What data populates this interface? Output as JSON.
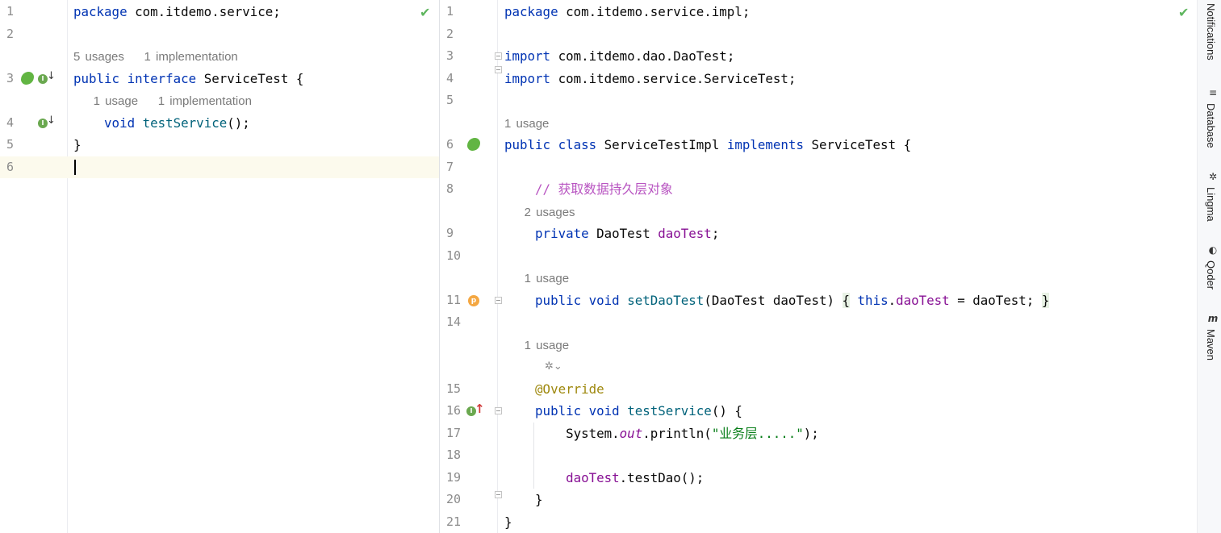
{
  "left_editor": {
    "lines": [
      {
        "num": "1",
        "code": [
          {
            "t": "package",
            "c": "kw"
          },
          {
            "t": " com.itdemo.service;"
          }
        ]
      },
      {
        "num": "2",
        "code": []
      },
      {
        "hint": "5 usages    1 implementation"
      },
      {
        "num": "3",
        "code": [
          {
            "t": "public",
            "c": "kw"
          },
          {
            "t": " "
          },
          {
            "t": "interface",
            "c": "kw"
          },
          {
            "t": " ServiceTest {"
          }
        ]
      },
      {
        "hint": "    1 usage    1 implementation"
      },
      {
        "num": "4",
        "code": [
          {
            "t": "    "
          },
          {
            "t": "void",
            "c": "kw"
          },
          {
            "t": " "
          },
          {
            "t": "testService",
            "c": "fn"
          },
          {
            "t": "();"
          }
        ]
      },
      {
        "num": "5",
        "code": [
          {
            "t": "}"
          }
        ]
      },
      {
        "num": "6",
        "code": [],
        "current": true
      }
    ]
  },
  "right_editor": {
    "lines": [
      {
        "num": "1",
        "code": [
          {
            "t": "package",
            "c": "kw"
          },
          {
            "t": " com.itdemo.service.impl;"
          }
        ]
      },
      {
        "num": "2",
        "code": []
      },
      {
        "num": "3",
        "code": [
          {
            "t": "import",
            "c": "kw"
          },
          {
            "t": " com.itdemo.dao.DaoTest;"
          }
        ]
      },
      {
        "num": "4",
        "code": [
          {
            "t": "import",
            "c": "kw"
          },
          {
            "t": " com.itdemo.service.ServiceTest;"
          }
        ]
      },
      {
        "num": "5",
        "code": []
      },
      {
        "hint": "1 usage"
      },
      {
        "num": "6",
        "code": [
          {
            "t": "public",
            "c": "kw"
          },
          {
            "t": " "
          },
          {
            "t": "class",
            "c": "kw"
          },
          {
            "t": " ServiceTestImpl "
          },
          {
            "t": "implements",
            "c": "kw"
          },
          {
            "t": " ServiceTest {"
          }
        ]
      },
      {
        "num": "7",
        "code": []
      },
      {
        "num": "8",
        "code": [
          {
            "t": "    "
          },
          {
            "t": "// 获取数据持久层对象",
            "c": "cmt"
          }
        ]
      },
      {
        "hint": "    2 usages"
      },
      {
        "num": "9",
        "code": [
          {
            "t": "    "
          },
          {
            "t": "private",
            "c": "kw"
          },
          {
            "t": " DaoTest "
          },
          {
            "t": "daoTest",
            "c": "fld"
          },
          {
            "t": ";"
          }
        ]
      },
      {
        "num": "10",
        "code": []
      },
      {
        "hint": "    1 usage"
      },
      {
        "num": "11",
        "code": [
          {
            "t": "    "
          },
          {
            "t": "public",
            "c": "kw"
          },
          {
            "t": " "
          },
          {
            "t": "void",
            "c": "kw"
          },
          {
            "t": " "
          },
          {
            "t": "setDaoTest",
            "c": "fn"
          },
          {
            "t": "(DaoTest daoTest) "
          },
          {
            "t": "{",
            "c": "brace-hl"
          },
          {
            "t": " "
          },
          {
            "t": "this",
            "c": "kw"
          },
          {
            "t": "."
          },
          {
            "t": "daoTest",
            "c": "fld"
          },
          {
            "t": " = daoTest; "
          },
          {
            "t": "}",
            "c": "brace-hl"
          }
        ]
      },
      {
        "num": "14",
        "code": []
      },
      {
        "hint": "    1 usage"
      },
      {
        "ai": true
      },
      {
        "num": "15",
        "code": [
          {
            "t": "    "
          },
          {
            "t": "@Override",
            "c": "ann"
          }
        ]
      },
      {
        "num": "16",
        "code": [
          {
            "t": "    "
          },
          {
            "t": "public",
            "c": "kw"
          },
          {
            "t": " "
          },
          {
            "t": "void",
            "c": "kw"
          },
          {
            "t": " "
          },
          {
            "t": "testService",
            "c": "fn"
          },
          {
            "t": "() {"
          }
        ]
      },
      {
        "num": "17",
        "code": [
          {
            "t": "        System."
          },
          {
            "t": "out",
            "c": "fld it"
          },
          {
            "t": ".println("
          },
          {
            "t": "\"业务层.....\"",
            "c": "str"
          },
          {
            "t": ");"
          }
        ]
      },
      {
        "num": "18",
        "code": []
      },
      {
        "num": "19",
        "code": [
          {
            "t": "        "
          },
          {
            "t": "daoTest",
            "c": "fld"
          },
          {
            "t": ".testDao();"
          }
        ]
      },
      {
        "num": "20",
        "code": [
          {
            "t": "    }"
          }
        ]
      },
      {
        "num": "21",
        "code": [
          {
            "t": "}"
          }
        ]
      }
    ]
  },
  "toolbar": {
    "items": [
      {
        "label": "Notifications",
        "icon": "bell-icon"
      },
      {
        "label": "Database",
        "icon": "database-icon"
      },
      {
        "label": "Lingma",
        "icon": "lingma-icon"
      },
      {
        "label": "Qoder",
        "icon": "qoder-icon"
      },
      {
        "label": "Maven",
        "icon": "maven-icon"
      }
    ]
  },
  "status": {
    "no_problems_icon": "checkmark-icon"
  }
}
